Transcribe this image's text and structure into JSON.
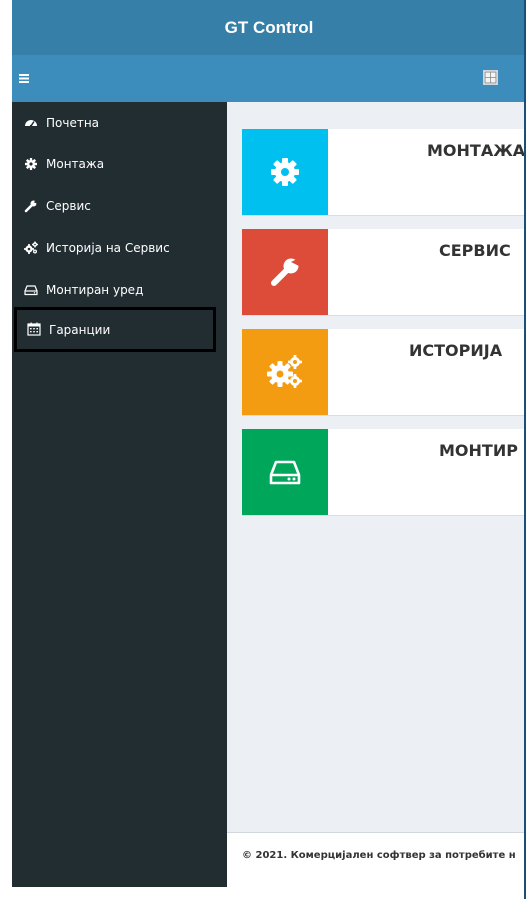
{
  "app": {
    "title": "GT Control"
  },
  "navbar": {
    "menu_icon": "hamburger-icon",
    "language_icon": "language-flag-icon"
  },
  "sidebar": {
    "items": [
      {
        "label": "Почетна",
        "icon": "dashboard-icon"
      },
      {
        "label": "Монтажа",
        "icon": "gear-icon"
      },
      {
        "label": "Сервис",
        "icon": "wrench-icon"
      },
      {
        "label": "Историја на Сервис",
        "icon": "gears-icon"
      },
      {
        "label": "Монтиран уред",
        "icon": "hdd-icon"
      },
      {
        "label": "Гаранции",
        "icon": "calendar-icon"
      }
    ],
    "selected_index": 5
  },
  "dashboard": {
    "boxes": [
      {
        "label": "МОНТАЖА",
        "color": "#00c0ef",
        "icon": "gear-icon"
      },
      {
        "label": "СЕРВИС",
        "color": "#dd4b39",
        "icon": "wrench-icon"
      },
      {
        "label": "ИСТОРИЈА",
        "color": "#f39c12",
        "icon": "gears-icon"
      },
      {
        "label": "МОНТИР",
        "color": "#00a65a",
        "icon": "hdd-icon"
      }
    ]
  },
  "footer": {
    "text": "© 2021. Комерцијален софтвер за потребите н"
  },
  "colors": {
    "header_dark": "#367fa9",
    "header": "#3c8dbc",
    "sidebar": "#222d32",
    "content_bg": "#ecf0f5"
  }
}
